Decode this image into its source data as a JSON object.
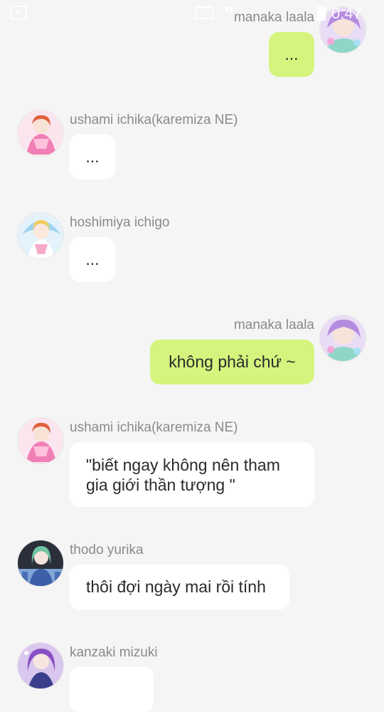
{
  "status_bar": {
    "time": "0:47"
  },
  "messages": [
    {
      "sender": "manaka laala",
      "text": "...",
      "direction": "outgoing",
      "avatar_icon": "laala-avatar-icon"
    },
    {
      "sender": "ushami ichika(karemiza NE)",
      "text": "...",
      "direction": "incoming",
      "avatar_icon": "ichika-avatar-icon"
    },
    {
      "sender": "hoshimiya ichigo",
      "text": "...",
      "direction": "incoming",
      "avatar_icon": "ichigo-avatar-icon"
    },
    {
      "sender": "manaka laala",
      "text": "không phải chứ ~",
      "direction": "outgoing",
      "avatar_icon": "laala-avatar-icon"
    },
    {
      "sender": "ushami ichika(karemiza NE)",
      "text": "\"biết ngay không nên tham gia giới thần tượng \"",
      "direction": "incoming",
      "avatar_icon": "ichika-avatar-icon"
    },
    {
      "sender": "thodo yurika",
      "text": "thôi đợi ngày mai rồi tính",
      "direction": "incoming",
      "avatar_icon": "yurika-avatar-icon"
    },
    {
      "sender": "kanzaki mizuki",
      "text": "",
      "direction": "incoming",
      "avatar_icon": "mizuki-avatar-icon"
    }
  ],
  "colors": {
    "background": "#f5f5f5",
    "outgoing_bubble": "#d4f47e",
    "incoming_bubble": "#ffffff",
    "sender_name": "#8a8a8a",
    "message_text": "#2a2a2a"
  }
}
